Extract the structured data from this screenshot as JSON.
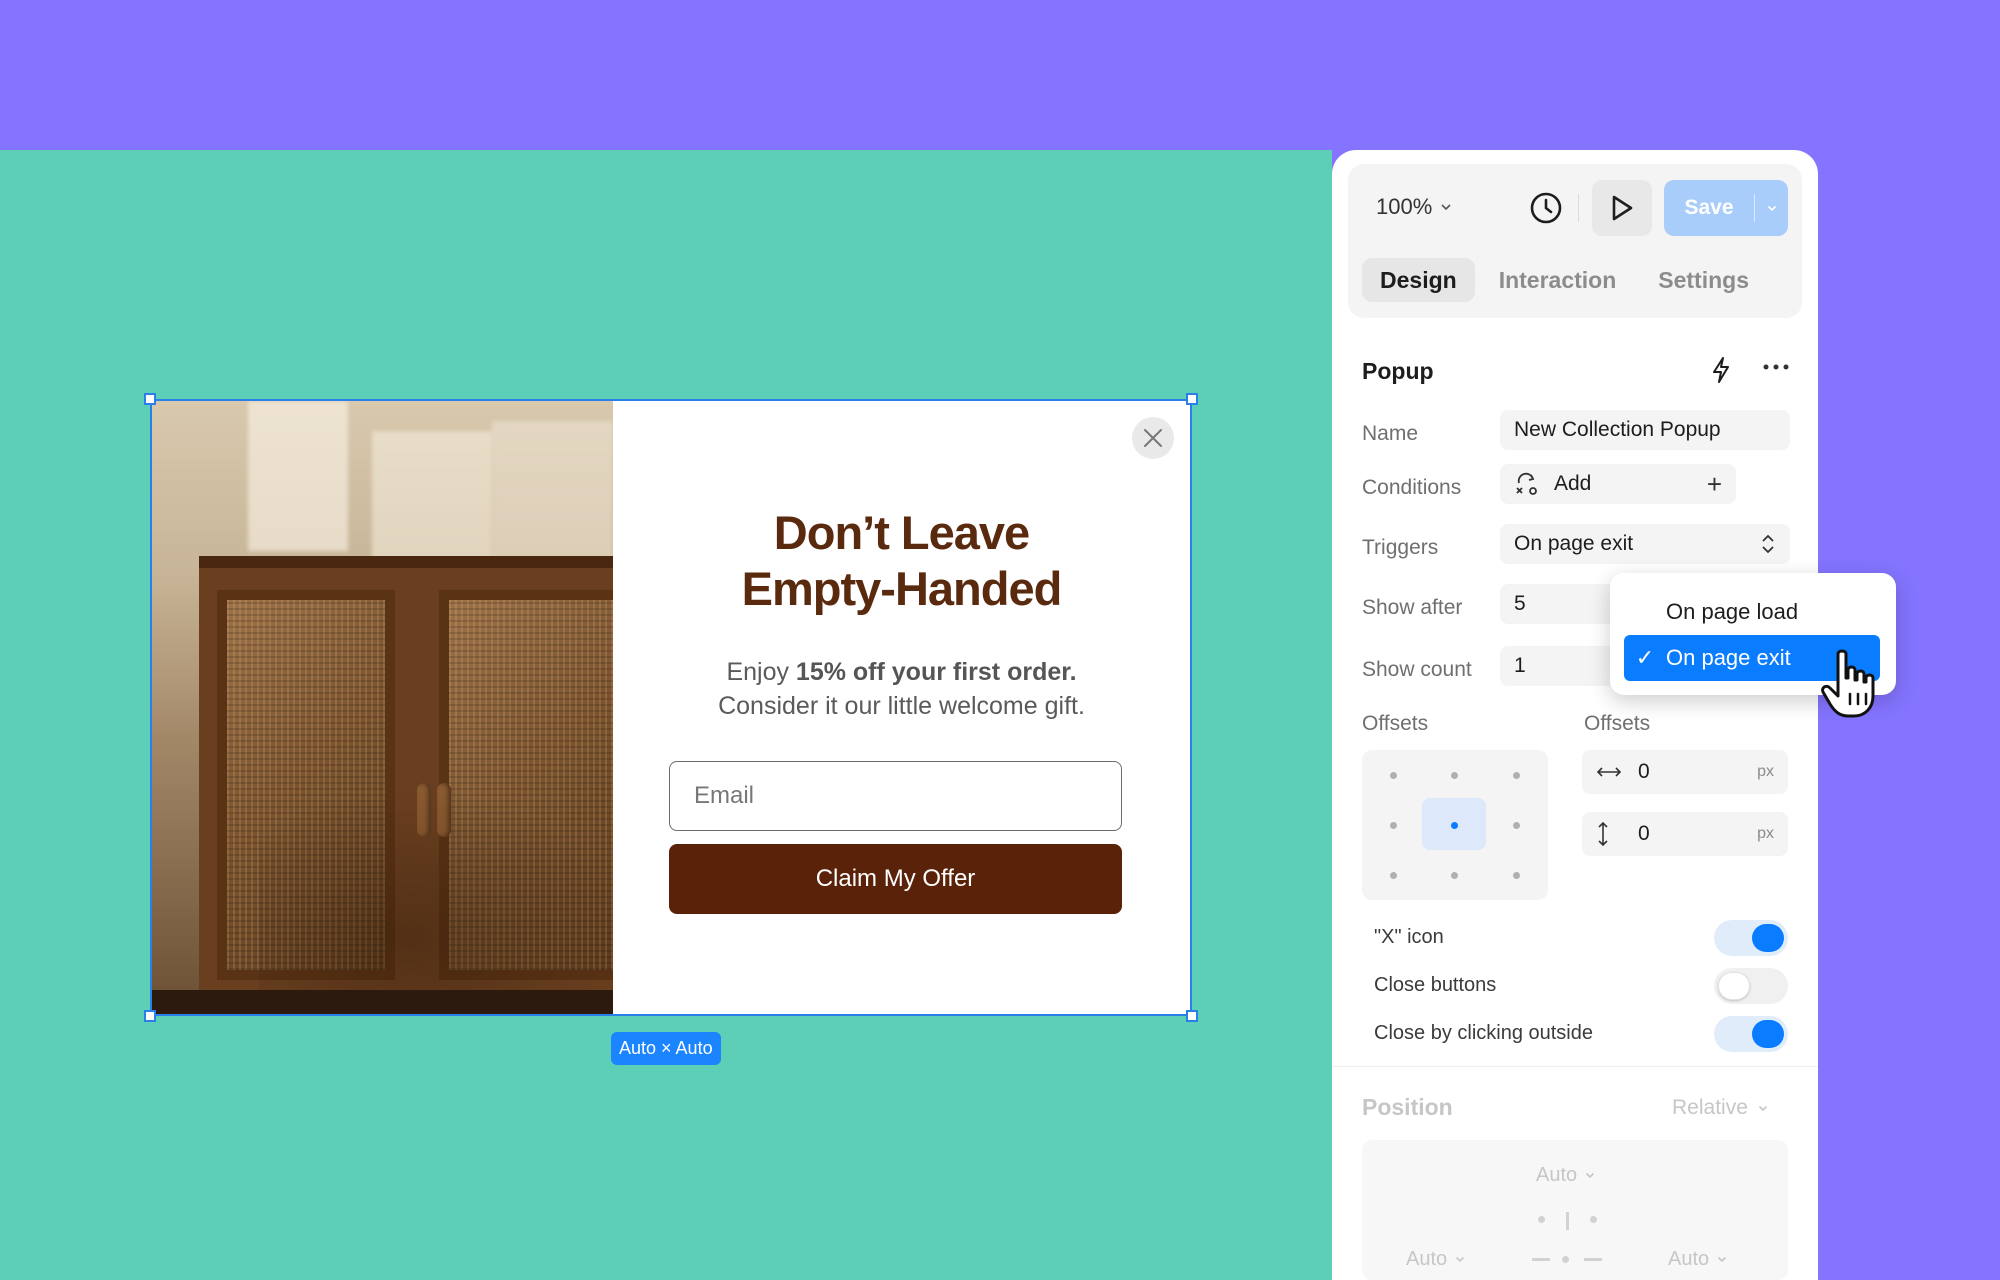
{
  "popup": {
    "title_line1": "Don’t Leave",
    "title_line2": "Empty-Handed",
    "subtitle_prefix": "Enjoy ",
    "subtitle_bold": "15% off your first order.",
    "subtitle_line2": "Consider it our little welcome gift.",
    "email_placeholder": "Email",
    "cta_label": "Claim My Offer",
    "size_badge": "Auto × Auto"
  },
  "toolbar": {
    "zoom": "100%",
    "save_label": "Save"
  },
  "tabs": [
    {
      "label": "Design",
      "active": true
    },
    {
      "label": "Interaction",
      "active": false
    },
    {
      "label": "Settings",
      "active": false
    }
  ],
  "section": {
    "title": "Popup",
    "name_label": "Name",
    "name_value": "New Collection Popup",
    "conditions_label": "Conditions",
    "conditions_value": "Add",
    "triggers_label": "Triggers",
    "triggers_value": "On page exit",
    "show_after_label": "Show after",
    "show_after_value": "5",
    "show_count_label": "Show count",
    "show_count_value": "1",
    "offsets_label_1": "Offsets",
    "offsets_label_2": "Offsets",
    "offset_x": "0",
    "offset_y": "0",
    "unit": "px"
  },
  "dropdown": {
    "options": [
      {
        "label": "On page load",
        "selected": false
      },
      {
        "label": "On page exit",
        "selected": true
      }
    ],
    "check": "✓"
  },
  "toggles": [
    {
      "label": "\"X\" icon",
      "on": true
    },
    {
      "label": "Close buttons",
      "on": false
    },
    {
      "label": "Close by clicking outside",
      "on": true
    }
  ],
  "position": {
    "title": "Position",
    "value": "Relative",
    "top": "Auto",
    "left": "Auto",
    "right": "Auto"
  },
  "colors": {
    "background": "#8474ff",
    "canvas": "#5dcfb7",
    "brand_brown": "#5a2208",
    "accent_blue": "#0a7cff"
  }
}
